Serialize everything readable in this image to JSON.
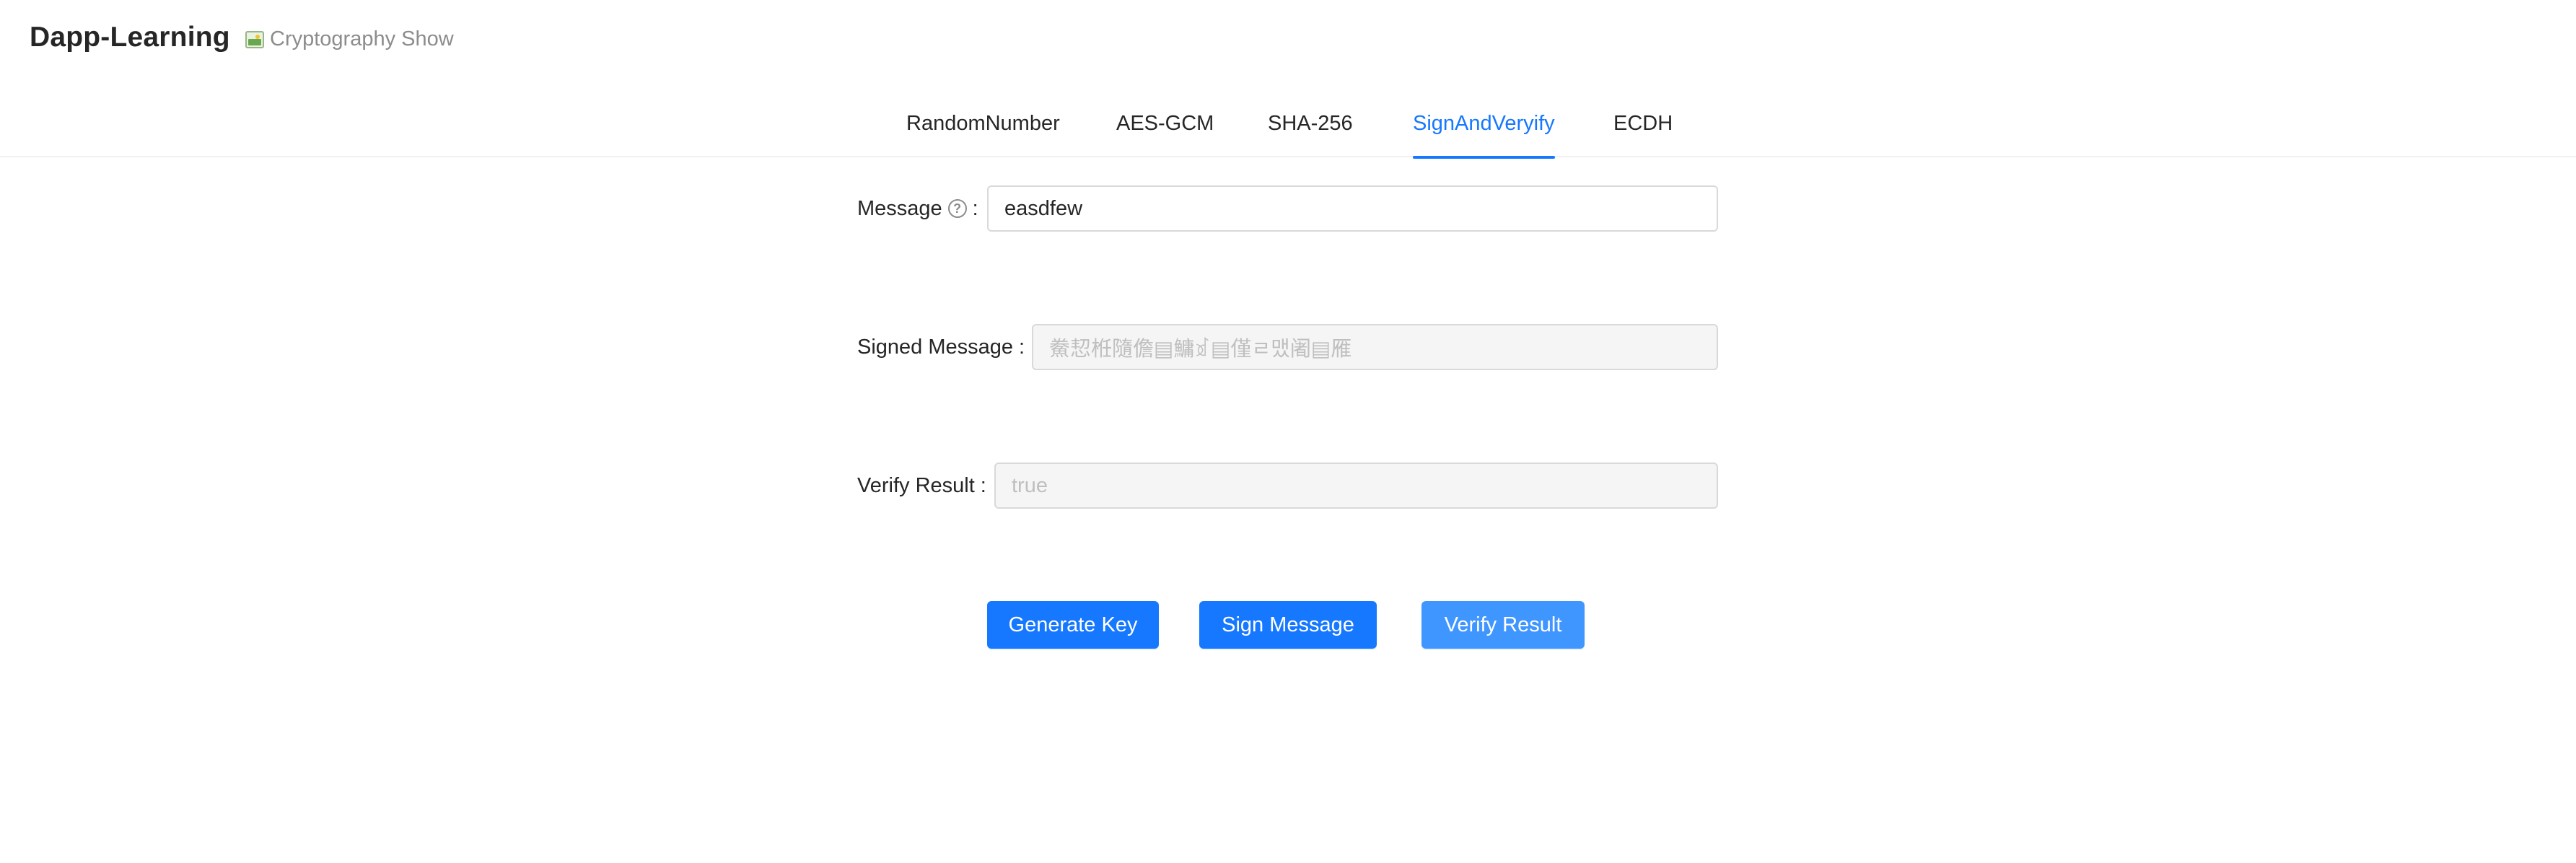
{
  "header": {
    "app_title": "Dapp-Learning",
    "subtitle": "Cryptography Show",
    "subtitle_icon": "image-icon"
  },
  "tabs": [
    {
      "label": "RandomNumber",
      "active": false
    },
    {
      "label": "AES-GCM",
      "active": false
    },
    {
      "label": "SHA-256",
      "active": false
    },
    {
      "label": "SignAndVeryify",
      "active": true
    },
    {
      "label": "ECDH",
      "active": false
    }
  ],
  "form": {
    "message": {
      "label": "Message",
      "help_icon": "question-circle-icon",
      "value": "easdfew"
    },
    "signed_message": {
      "label": "Signed Message",
      "value": "鮝恝栣隨儋▤鱅ꀃ▤僅ㄹ맸阇▤雁"
    },
    "verify_result": {
      "label": "Verify Result",
      "value": "true"
    }
  },
  "buttons": {
    "generate_key": "Generate Key",
    "sign_message": "Sign Message",
    "verify_result": "Verify Result"
  },
  "colors": {
    "primary": "#1677ff",
    "primary_light": "#4096ff",
    "text": "#262626",
    "muted": "#8c8c8c"
  }
}
